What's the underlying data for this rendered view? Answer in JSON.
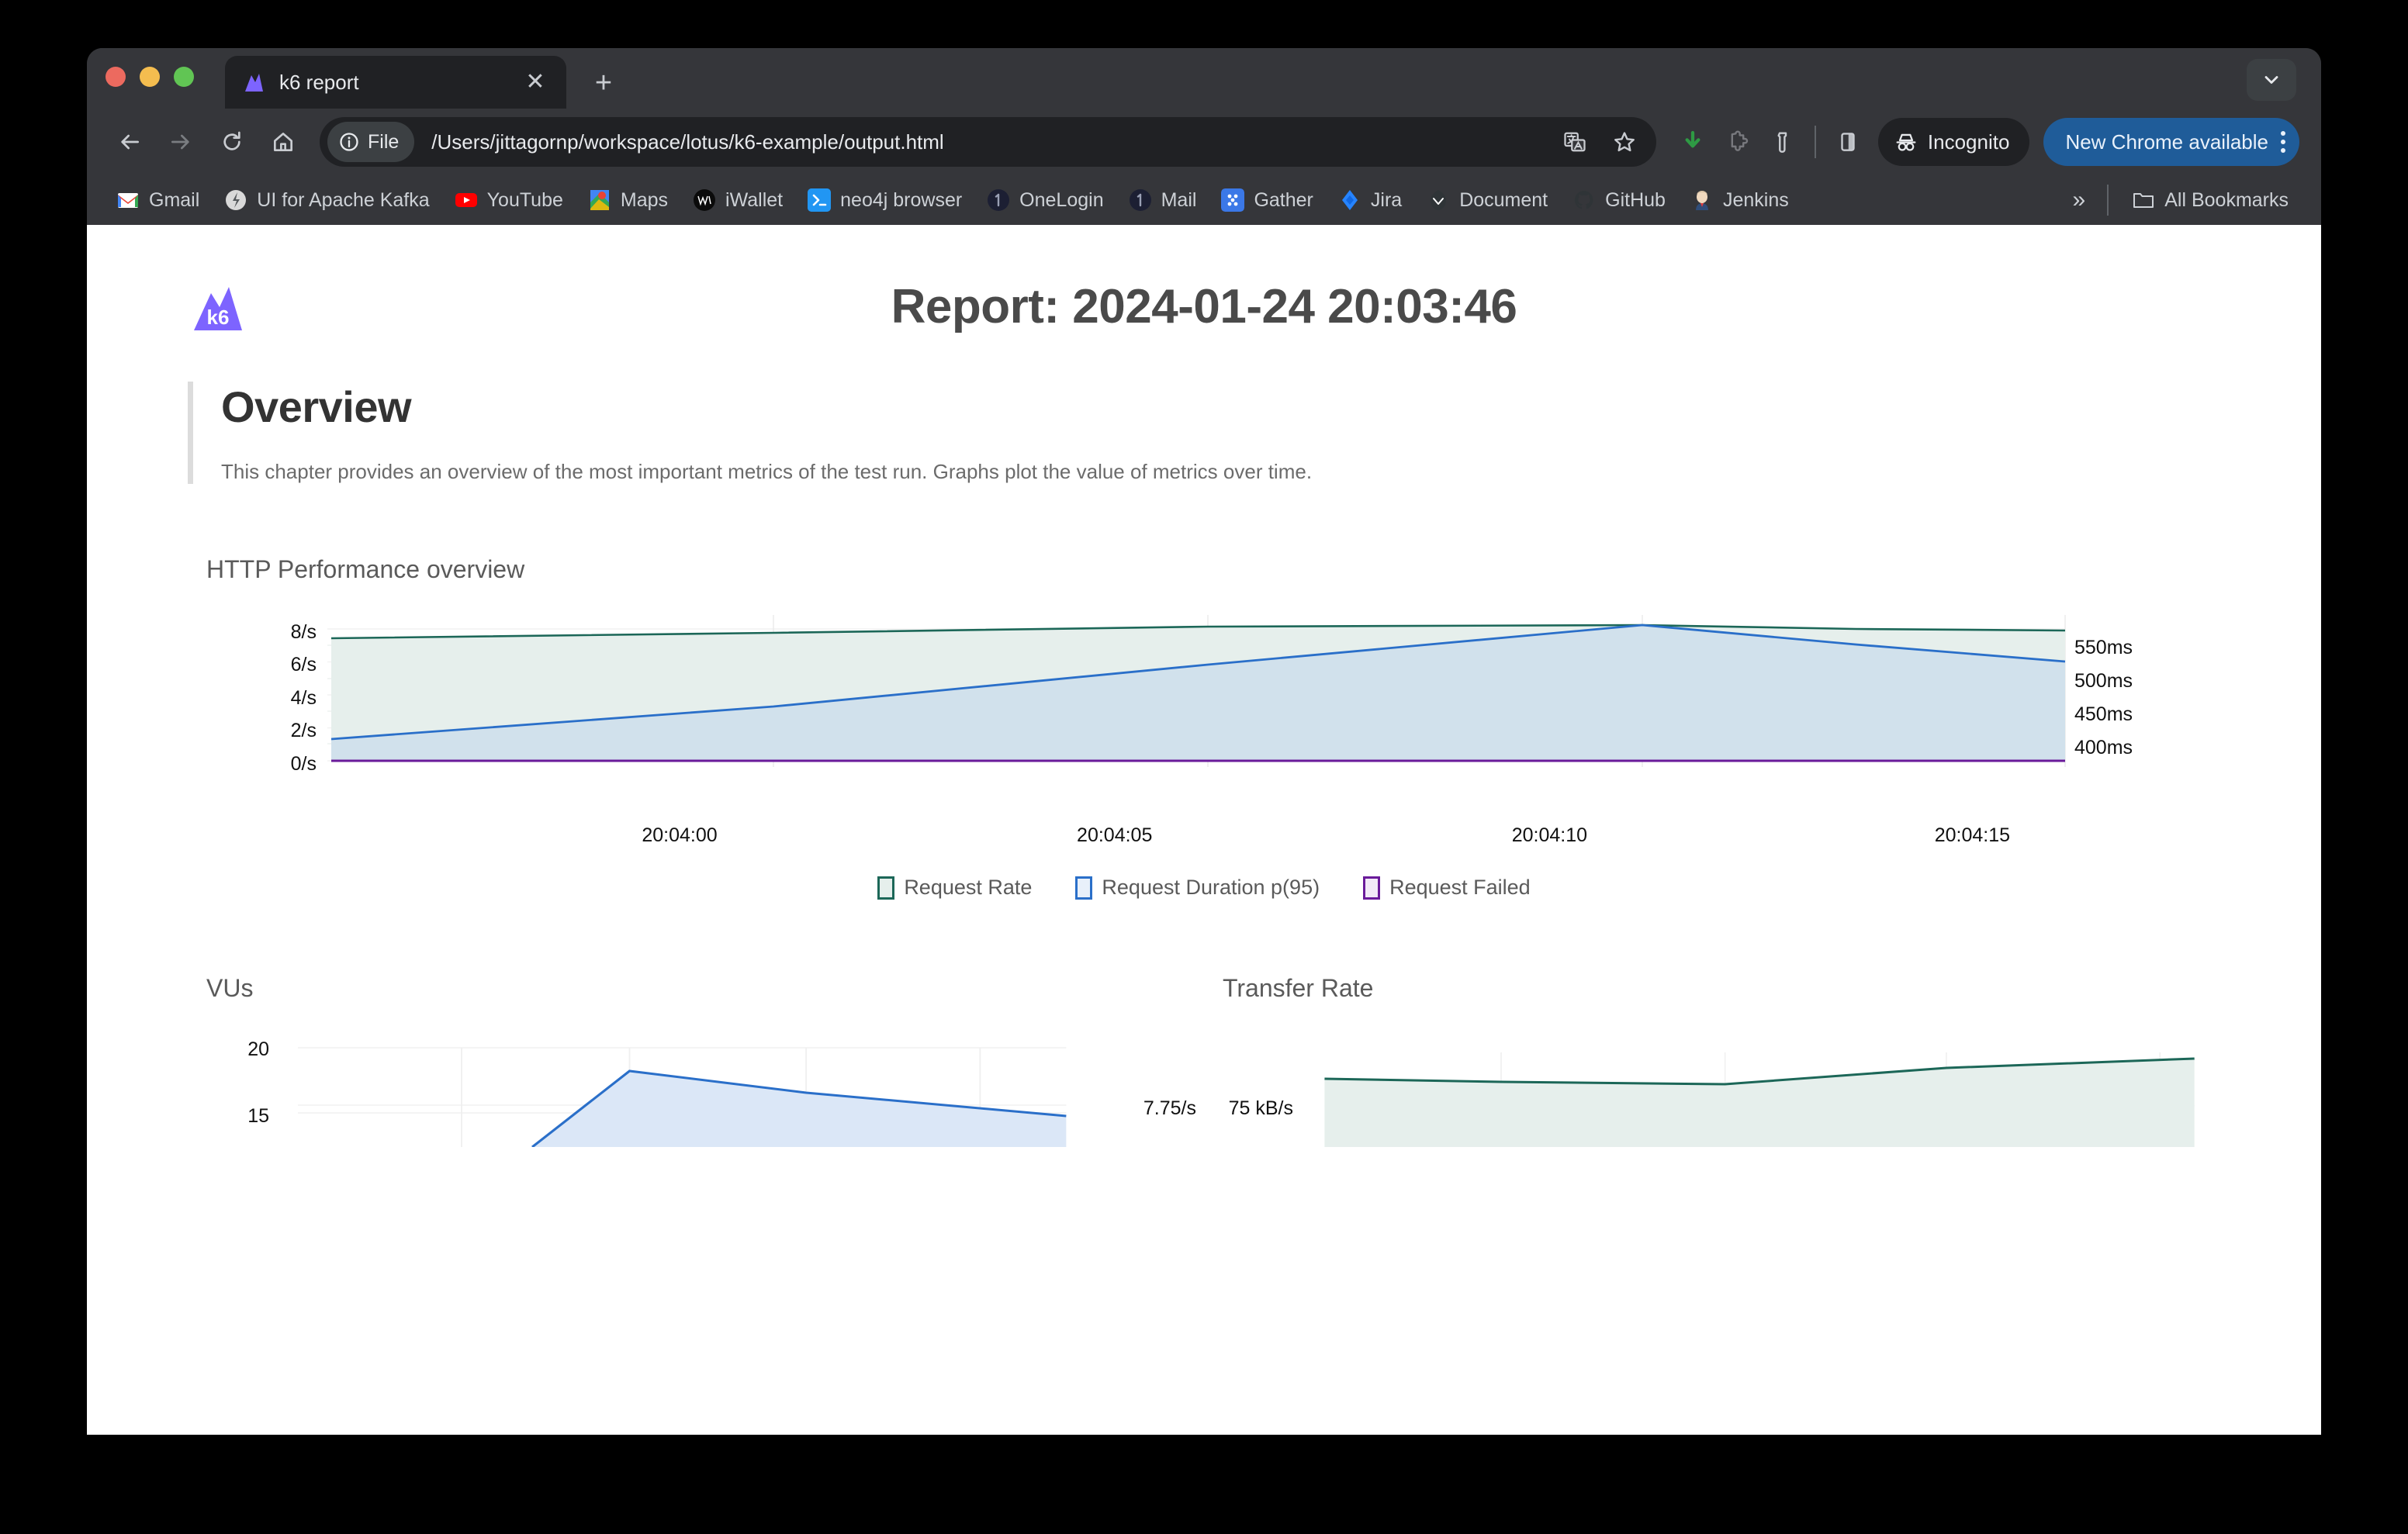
{
  "browser": {
    "tab": {
      "title": "k6 report",
      "favicon": "k6-mountain-icon",
      "close": "✕"
    },
    "new_tab": "+",
    "tab_search_icon": "chevron-down-icon",
    "nav": {
      "back": "back-icon",
      "forward": "forward-icon",
      "reload": "reload-icon",
      "home": "home-icon"
    },
    "omnibox": {
      "scheme_chip": "File",
      "url": "/Users/jittagornp/workspace/lotus/k6-example/output.html",
      "translate_icon": "translate-icon",
      "bookmark_icon": "star-icon"
    },
    "actions": {
      "download_icon": "download-icon",
      "extension_puzzle_icon": "puzzle-icon",
      "profile_icon": "profile-icon",
      "side_panel_icon": "side-panel-icon",
      "incognito_label": "Incognito",
      "incognito_icon": "incognito-icon",
      "update_label": "New Chrome available",
      "menu_icon": "kebab-menu-icon"
    },
    "bookmarks": [
      {
        "label": "Gmail",
        "icon": "gmail-icon"
      },
      {
        "label": "UI for Apache Kafka",
        "icon": "kafka-icon"
      },
      {
        "label": "YouTube",
        "icon": "youtube-icon"
      },
      {
        "label": "Maps",
        "icon": "maps-icon"
      },
      {
        "label": "iWallet",
        "icon": "iwallet-icon"
      },
      {
        "label": "neo4j browser",
        "icon": "neo4j-icon"
      },
      {
        "label": "OneLogin",
        "icon": "onelogin-icon"
      },
      {
        "label": "Mail",
        "icon": "mail-icon"
      },
      {
        "label": "Gather",
        "icon": "gather-icon"
      },
      {
        "label": "Jira",
        "icon": "jira-icon"
      },
      {
        "label": "Document",
        "icon": "document-icon"
      },
      {
        "label": "GitHub",
        "icon": "github-icon"
      },
      {
        "label": "Jenkins",
        "icon": "jenkins-icon"
      }
    ],
    "bookmarks_overflow": "»",
    "all_bookmarks": {
      "label": "All Bookmarks",
      "icon": "folder-icon"
    }
  },
  "report": {
    "logo": "k6-logo",
    "title": "Report: 2024-01-24 20:03:46",
    "overview": {
      "heading": "Overview",
      "description": "This chapter provides an overview of the most important metrics of the test run. Graphs plot the value of metrics over time."
    }
  },
  "colors": {
    "request_rate": "#1c6758",
    "request_duration": "#2a6fc9",
    "request_failed": "#6a1b9a",
    "k6_purple": "#7d64ff",
    "update_blue": "#1f5c99"
  },
  "chart_data": [
    {
      "id": "http-performance-overview",
      "type": "line",
      "title": "HTTP Performance overview",
      "x": [
        "20:04:00",
        "20:04:05",
        "20:04:10",
        "20:04:15"
      ],
      "x_tick_labels": [
        "20:04:00",
        "20:04:05",
        "20:04:10",
        "20:04:15"
      ],
      "xlabel": "",
      "left_axis": {
        "ylabel": "",
        "tick_labels": [
          "0/s",
          "2/s",
          "4/s",
          "6/s",
          "8/s"
        ],
        "ticks": [
          0,
          2,
          4,
          6,
          8
        ],
        "ylim": [
          0,
          8
        ]
      },
      "right_axis": {
        "ylabel": "",
        "tick_labels": [
          "400ms",
          "450ms",
          "500ms",
          "550ms"
        ],
        "ticks": [
          400,
          450,
          500,
          550
        ],
        "ylim": [
          385,
          575
        ]
      },
      "grid": true,
      "legend_position": "bottom",
      "series": [
        {
          "name": "Request Rate",
          "axis": "left",
          "color": "#1c6758",
          "fill": "#e6efec",
          "values": [
            6.95,
            7.3,
            7.55,
            7.6,
            7.45,
            7.4
          ]
        },
        {
          "name": "Request Duration p(95)",
          "axis": "right",
          "color": "#2a6fc9",
          "fill": "#cfdfec",
          "values": [
            403,
            455,
            520,
            570,
            540,
            512
          ]
        },
        {
          "name": "Request Failed",
          "axis": "left",
          "color": "#6a1b9a",
          "fill": "#ece3f2",
          "values": [
            0,
            0,
            0,
            0,
            0,
            0
          ]
        }
      ]
    },
    {
      "id": "vus",
      "type": "line",
      "title": "VUs",
      "left_axis": {
        "tick_labels": [
          "15",
          "20"
        ],
        "ticks": [
          15,
          20
        ],
        "ylim": [
          0,
          22
        ]
      },
      "right_axis": {
        "tick_labels": [
          "7.75/s"
        ],
        "ticks": [
          7.75
        ]
      },
      "grid": true,
      "series": [
        {
          "name": "VUs",
          "color": "#2a6fc9",
          "fill": "#dbe7f7",
          "values": [
            0,
            0,
            4,
            18.5,
            16.5,
            14.8
          ]
        }
      ]
    },
    {
      "id": "transfer-rate",
      "type": "area",
      "title": "Transfer Rate",
      "left_axis": {
        "tick_labels": [
          "75 kB/s"
        ],
        "ticks": [
          75
        ]
      },
      "grid": true,
      "series": [
        {
          "name": "Transfer Rate",
          "color": "#1c6758",
          "fill": "#e6efec",
          "values": [
            82,
            81.2,
            80.5,
            80.3,
            84,
            87.5
          ]
        }
      ]
    }
  ]
}
